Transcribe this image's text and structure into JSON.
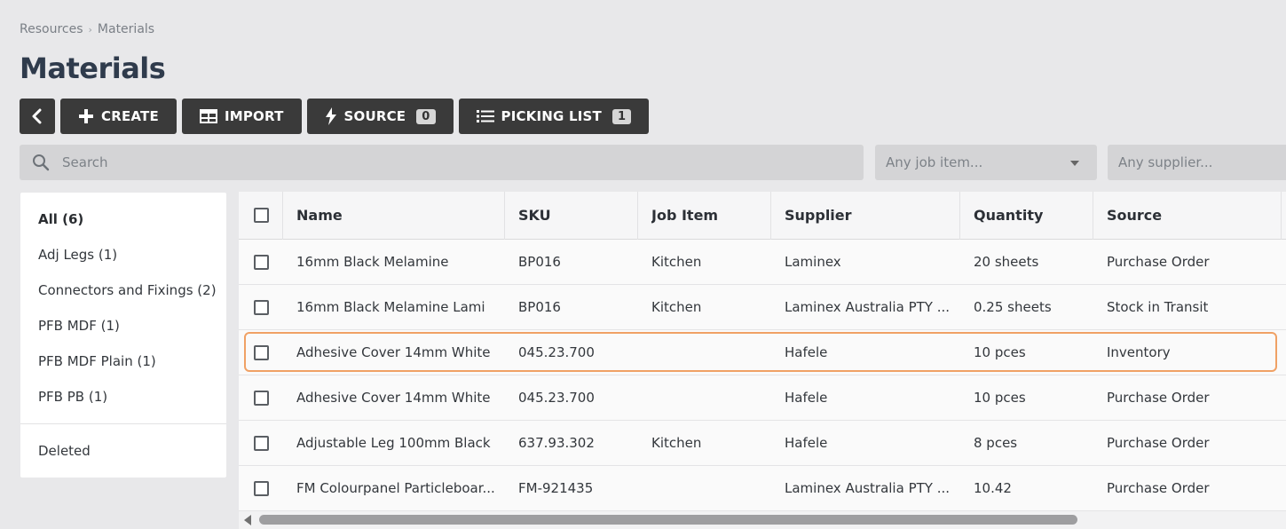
{
  "breadcrumb": {
    "parent": "Resources",
    "separator": "›",
    "current": "Materials"
  },
  "page_title": "Materials",
  "toolbar": {
    "create_label": "CREATE",
    "import_label": "IMPORT",
    "source_label": "SOURCE",
    "source_count": "0",
    "picking_label": "PICKING LIST",
    "picking_count": "1"
  },
  "search": {
    "placeholder": "Search"
  },
  "filters": {
    "job_placeholder": "Any job item...",
    "supplier_placeholder": "Any supplier..."
  },
  "sidebar": {
    "items": [
      {
        "label": "All (6)"
      },
      {
        "label": "Adj Legs (1)"
      },
      {
        "label": "Connectors and Fixings (2)"
      },
      {
        "label": "PFB MDF (1)"
      },
      {
        "label": "PFB MDF Plain (1)"
      },
      {
        "label": "PFB PB (1)"
      }
    ],
    "deleted_label": "Deleted"
  },
  "table": {
    "columns": [
      "Name",
      "SKU",
      "Job Item",
      "Supplier",
      "Quantity",
      "Source"
    ],
    "rows": [
      {
        "name": "16mm Black Melamine",
        "sku": "BP016",
        "job": "Kitchen",
        "supplier": "Laminex",
        "qty": "20 sheets",
        "source": "Purchase Order"
      },
      {
        "name": "16mm Black Melamine Lami",
        "sku": "BP016",
        "job": "Kitchen",
        "supplier": "Laminex Australia PTY ...",
        "qty": "0.25 sheets",
        "source": "Stock in Transit"
      },
      {
        "name": "Adhesive Cover 14mm White",
        "sku": "045.23.700",
        "job": "",
        "supplier": "Hafele",
        "qty": "10 pces",
        "source": "Inventory"
      },
      {
        "name": "Adhesive Cover 14mm White",
        "sku": "045.23.700",
        "job": "",
        "supplier": "Hafele",
        "qty": "10 pces",
        "source": "Purchase Order"
      },
      {
        "name": "Adjustable Leg 100mm Black",
        "sku": "637.93.302",
        "job": "Kitchen",
        "supplier": "Hafele",
        "qty": "8 pces",
        "source": "Purchase Order"
      },
      {
        "name": "FM Colourpanel Particleboar...",
        "sku": "FM-921435",
        "job": "",
        "supplier": "Laminex Australia PTY ...",
        "qty": "10.42",
        "source": "Purchase Order"
      }
    ]
  },
  "colors": {
    "toolbar_bg": "#3a3a3a",
    "highlight_border": "#f0a165",
    "title": "#2f3b4c"
  }
}
